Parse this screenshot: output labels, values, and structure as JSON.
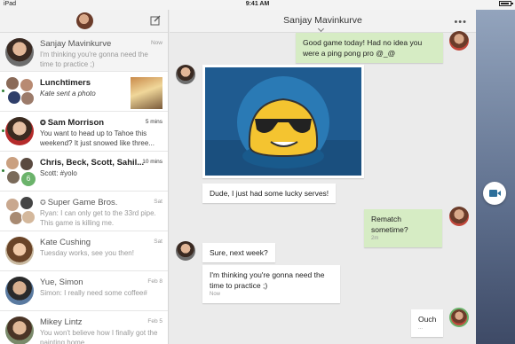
{
  "status_bar": {
    "carrier": "iPad",
    "time": "9:41 AM"
  },
  "sidebar": {
    "conversations": [
      {
        "name": "Sanjay Mavinkurve",
        "time": "Now",
        "snippet": "I'm thinking you're gonna need the time to practice ;)"
      },
      {
        "name": "Lunchtimers",
        "time": "",
        "snippet": "Kate sent a photo"
      },
      {
        "name": "Sam Morrison",
        "time": "5 mins",
        "snippet": "You want to head up to Tahoe this weekend? It just snowed like three..."
      },
      {
        "name": "Chris, Beck, Scott, Sahil...",
        "time": "10 mins",
        "snippet": "Scott: #yolo",
        "badge": "6"
      },
      {
        "name": "Super Game Bros.",
        "time": "Sat",
        "snippet": "Ryan: I can only get to the 33rd pipe. This game is killing me."
      },
      {
        "name": "Kate Cushing",
        "time": "Sat",
        "snippet": "Tuesday works, see you then!"
      },
      {
        "name": "Yue, Simon",
        "time": "Feb 8",
        "snippet": "Simon: I really need some coffee#"
      },
      {
        "name": "Mikey Lintz",
        "time": "Feb 5",
        "snippet": "You won't believe how I finally got the painting home"
      }
    ]
  },
  "chat": {
    "title": "Sanjay Mavinkurve",
    "messages": [
      {
        "text": "Good game today! Had no idea you were a ping pong pro @_@"
      },
      {
        "text": "Dude, I just had some lucky serves!"
      },
      {
        "text": "Rematch sometime?",
        "meta": "2m"
      },
      {
        "text": "Sure, next week?"
      },
      {
        "text": "I'm thinking you're gonna need the time to practice ;)",
        "meta": "Now"
      },
      {
        "text": "Ouch",
        "meta": "..."
      }
    ]
  },
  "colors": {
    "my_bubble": "#d6ecc4",
    "their_bubble": "#ffffff",
    "video_accent": "#2d6f9a"
  },
  "icons": {
    "compose": "compose-icon",
    "more": "more-icon",
    "video": "video-call-icon"
  }
}
